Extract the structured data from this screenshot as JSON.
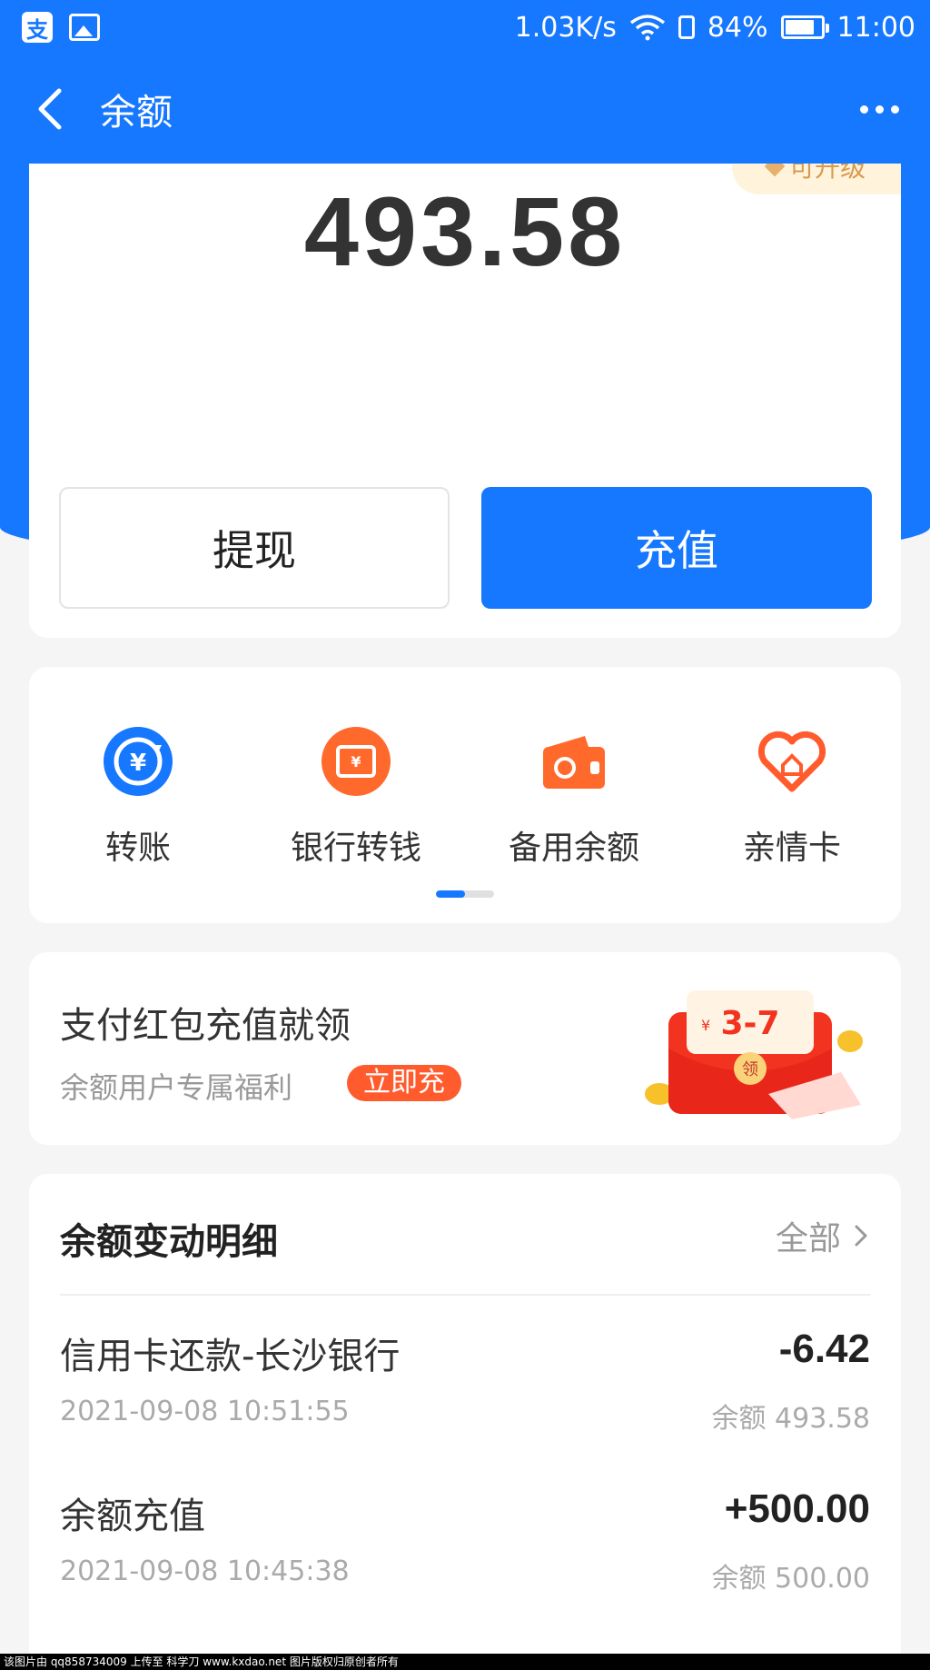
{
  "status_bar": {
    "net_speed": "1.03K/s",
    "battery": "84%",
    "battery_level": 0.84,
    "time": "11:00"
  },
  "header": {
    "title": "余额"
  },
  "balance": {
    "upgrade_badge": "可升级",
    "amount": "493.58",
    "withdraw_label": "提现",
    "recharge_label": "充值"
  },
  "actions": [
    {
      "label": "转账",
      "icon": "transfer-icon"
    },
    {
      "label": "银行转钱",
      "icon": "bank-transfer-icon"
    },
    {
      "label": "备用余额",
      "icon": "wallet-icon"
    },
    {
      "label": "亲情卡",
      "icon": "family-card-icon"
    }
  ],
  "promo": {
    "title": "支付红包充值就领",
    "subtitle": "余额用户专属福利",
    "button": "立即充",
    "badge_amount": "3-7",
    "badge_currency": "¥",
    "badge_action": "领"
  },
  "details": {
    "title": "余额变动明细",
    "all_label": "全部",
    "transactions": [
      {
        "name": "信用卡还款-长沙银行",
        "amount": "-6.42",
        "time": "2021-09-08 10:51:55",
        "balance": "余额 493.58"
      },
      {
        "name": "余额充值",
        "amount": "+500.00",
        "time": "2021-09-08 10:45:38",
        "balance": "余额 500.00"
      }
    ]
  },
  "watermark": "该图片由 qq858734009 上传至 科学刀 www.kxdao.net 图片版权归原创者所有",
  "colors": {
    "brand_blue": "#1677ff",
    "promo_orange": "#ff5b2d",
    "background": "#f5f5f5"
  }
}
